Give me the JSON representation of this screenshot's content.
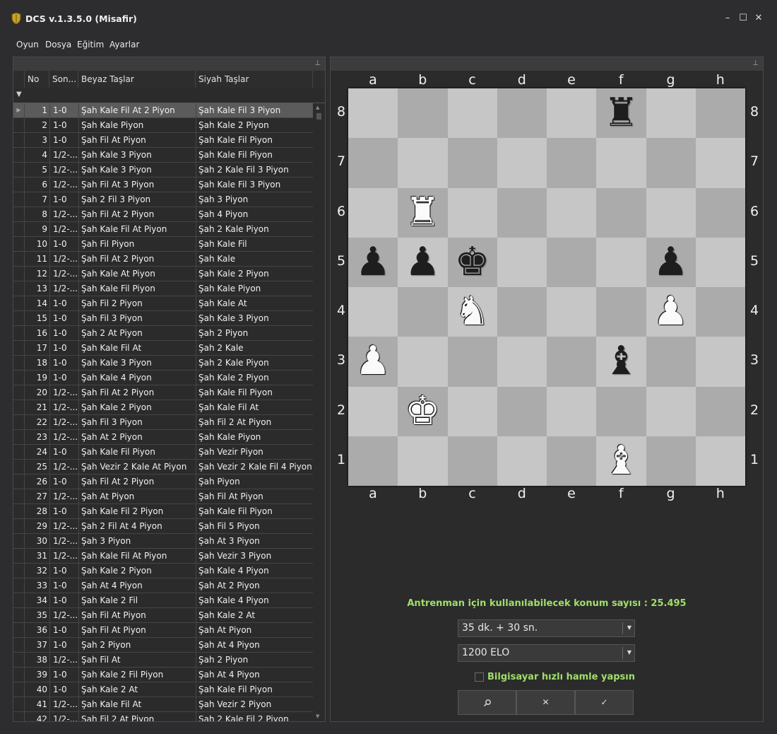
{
  "window": {
    "title": "DCS v.1.3.5.0 (Misafir)",
    "minimize_glyph": "–",
    "maximize_glyph": "☐",
    "close_glyph": "✕",
    "app_icon": "shield-icon"
  },
  "menu": [
    "Oyun",
    "Dosya",
    "Eğitim",
    "Ayarlar"
  ],
  "grid": {
    "headers": {
      "no": "No",
      "result": "Son...",
      "white": "Beyaz Taşlar",
      "black": "Siyah Taşlar"
    },
    "selected_index": 0,
    "rows": [
      {
        "no": "1",
        "result": "1-0",
        "white": "Şah Kale Fil At 2 Piyon",
        "black": "Şah Kale Fil 3 Piyon"
      },
      {
        "no": "2",
        "result": "1-0",
        "white": "Şah Kale Piyon",
        "black": "Şah Kale 2 Piyon"
      },
      {
        "no": "3",
        "result": "1-0",
        "white": "Şah Fil At Piyon",
        "black": "Şah Kale Fil Piyon"
      },
      {
        "no": "4",
        "result": "1/2-...",
        "white": "Şah Kale 3 Piyon",
        "black": "Şah Kale Fil Piyon"
      },
      {
        "no": "5",
        "result": "1/2-...",
        "white": "Şah Kale 3 Piyon",
        "black": "Şah 2 Kale Fil 3 Piyon"
      },
      {
        "no": "6",
        "result": "1/2-...",
        "white": "Şah Fil At 3 Piyon",
        "black": "Şah Kale Fil 3 Piyon"
      },
      {
        "no": "7",
        "result": "1-0",
        "white": "Şah 2 Fil 3 Piyon",
        "black": "Şah 3 Piyon"
      },
      {
        "no": "8",
        "result": "1/2-...",
        "white": "Şah Fil At 2 Piyon",
        "black": "Şah 4 Piyon"
      },
      {
        "no": "9",
        "result": "1/2-...",
        "white": "Şah Kale Fil At Piyon",
        "black": "Şah 2 Kale Piyon"
      },
      {
        "no": "10",
        "result": "1-0",
        "white": "Şah Fil Piyon",
        "black": "Şah Kale Fil"
      },
      {
        "no": "11",
        "result": "1/2-...",
        "white": "Şah Fil At 2 Piyon",
        "black": "Şah Kale"
      },
      {
        "no": "12",
        "result": "1/2-...",
        "white": "Şah Kale At Piyon",
        "black": "Şah Kale 2 Piyon"
      },
      {
        "no": "13",
        "result": "1/2-...",
        "white": "Şah Kale Fil Piyon",
        "black": "Şah Kale Piyon"
      },
      {
        "no": "14",
        "result": "1-0",
        "white": "Şah Fil 2 Piyon",
        "black": "Şah Kale At"
      },
      {
        "no": "15",
        "result": "1-0",
        "white": "Şah Fil 3 Piyon",
        "black": "Şah Kale 3 Piyon"
      },
      {
        "no": "16",
        "result": "1-0",
        "white": "Şah 2 At Piyon",
        "black": "Şah 2 Piyon"
      },
      {
        "no": "17",
        "result": "1-0",
        "white": "Şah Kale Fil At",
        "black": "Şah 2 Kale"
      },
      {
        "no": "18",
        "result": "1-0",
        "white": "Şah Kale 3 Piyon",
        "black": "Şah 2 Kale Piyon"
      },
      {
        "no": "19",
        "result": "1-0",
        "white": "Şah Kale 4 Piyon",
        "black": "Şah Kale 2 Piyon"
      },
      {
        "no": "20",
        "result": "1/2-...",
        "white": "Şah Fil At 2 Piyon",
        "black": "Şah Kale Fil Piyon"
      },
      {
        "no": "21",
        "result": "1/2-...",
        "white": "Şah Kale 2 Piyon",
        "black": "Şah Kale Fil At"
      },
      {
        "no": "22",
        "result": "1/2-...",
        "white": "Şah Fil 3 Piyon",
        "black": "Şah Fil 2 At Piyon"
      },
      {
        "no": "23",
        "result": "1/2-...",
        "white": "Şah At 2 Piyon",
        "black": "Şah Kale Piyon"
      },
      {
        "no": "24",
        "result": "1-0",
        "white": "Şah Kale Fil Piyon",
        "black": "Şah Vezir Piyon"
      },
      {
        "no": "25",
        "result": "1/2-...",
        "white": "Şah Vezir 2 Kale At Piyon",
        "black": "Şah Vezir 2 Kale Fil 4 Piyon"
      },
      {
        "no": "26",
        "result": "1-0",
        "white": "Şah Fil At 2 Piyon",
        "black": "Şah Piyon"
      },
      {
        "no": "27",
        "result": "1/2-...",
        "white": "Şah At Piyon",
        "black": "Şah Fil At Piyon"
      },
      {
        "no": "28",
        "result": "1-0",
        "white": "Şah Kale Fil 2 Piyon",
        "black": "Şah Kale Fil Piyon"
      },
      {
        "no": "29",
        "result": "1/2-...",
        "white": "Şah 2 Fil At 4 Piyon",
        "black": "Şah Fil 5 Piyon"
      },
      {
        "no": "30",
        "result": "1/2-...",
        "white": "Şah 3 Piyon",
        "black": "Şah At 3 Piyon"
      },
      {
        "no": "31",
        "result": "1/2-...",
        "white": "Şah Kale Fil At Piyon",
        "black": "Şah Vezir 3 Piyon"
      },
      {
        "no": "32",
        "result": "1-0",
        "white": "Şah Kale 2 Piyon",
        "black": "Şah Kale 4 Piyon"
      },
      {
        "no": "33",
        "result": "1-0",
        "white": "Şah At 4 Piyon",
        "black": "Şah At 2 Piyon"
      },
      {
        "no": "34",
        "result": "1-0",
        "white": "Şah Kale 2 Fil",
        "black": "Şah Kale 4 Piyon"
      },
      {
        "no": "35",
        "result": "1/2-...",
        "white": "Şah Fil At Piyon",
        "black": "Şah Kale 2 At"
      },
      {
        "no": "36",
        "result": "1-0",
        "white": "Şah Fil At Piyon",
        "black": "Şah At Piyon"
      },
      {
        "no": "37",
        "result": "1-0",
        "white": "Şah 2 Piyon",
        "black": "Şah At 4 Piyon"
      },
      {
        "no": "38",
        "result": "1/2-...",
        "white": "Şah Fil At",
        "black": "Şah 2 Piyon"
      },
      {
        "no": "39",
        "result": "1-0",
        "white": "Şah Kale 2 Fil Piyon",
        "black": "Şah At 4 Piyon"
      },
      {
        "no": "40",
        "result": "1-0",
        "white": "Şah Kale 2 At",
        "black": "Şah Kale Fil Piyon"
      },
      {
        "no": "41",
        "result": "1/2-...",
        "white": "Şah Kale Fil At",
        "black": "Şah Vezir 2 Piyon"
      },
      {
        "no": "42",
        "result": "1/2-...",
        "white": "Şah Fil 2 At Piyon",
        "black": "Şah 2 Kale Fil 2 Piyon"
      }
    ]
  },
  "board": {
    "files": [
      "a",
      "b",
      "c",
      "d",
      "e",
      "f",
      "g",
      "h"
    ],
    "ranks": [
      "8",
      "7",
      "6",
      "5",
      "4",
      "3",
      "2",
      "1"
    ],
    "pieces": [
      {
        "square": "f8",
        "color": "black",
        "type": "rook",
        "glyph": "♜"
      },
      {
        "square": "b6",
        "color": "white",
        "type": "rook",
        "glyph": "♜"
      },
      {
        "square": "a5",
        "color": "black",
        "type": "pawn",
        "glyph": "♟"
      },
      {
        "square": "b5",
        "color": "black",
        "type": "pawn",
        "glyph": "♟"
      },
      {
        "square": "c5",
        "color": "black",
        "type": "king",
        "glyph": "♚"
      },
      {
        "square": "g5",
        "color": "black",
        "type": "pawn",
        "glyph": "♟"
      },
      {
        "square": "c4",
        "color": "white",
        "type": "knight",
        "glyph": "♞"
      },
      {
        "square": "g4",
        "color": "white",
        "type": "pawn",
        "glyph": "♟"
      },
      {
        "square": "a3",
        "color": "white",
        "type": "pawn",
        "glyph": "♟"
      },
      {
        "square": "f3",
        "color": "black",
        "type": "bishop",
        "glyph": "♝"
      },
      {
        "square": "b2",
        "color": "white",
        "type": "king",
        "glyph": "♚"
      },
      {
        "square": "f1",
        "color": "white",
        "type": "bishop",
        "glyph": "♝"
      }
    ]
  },
  "training": {
    "positions_text": "Antrenman için kullanılabilecek konum sayısı : 25.495",
    "time_control": "35 dk. + 30 sn.",
    "elo": "1200 ELO",
    "fast_move_label": "Bilgisayar hızlı hamle yapsın",
    "fast_move_checked": false,
    "buttons": [
      {
        "name": "search-button",
        "icon": "magnifier-icon",
        "glyph": "⚲"
      },
      {
        "name": "cancel-button",
        "icon": "close-icon",
        "glyph": "✕"
      },
      {
        "name": "confirm-button",
        "icon": "check-icon",
        "glyph": "✓"
      }
    ]
  },
  "colors": {
    "accent_text": "#9fdf6a",
    "background": "#2d2d30",
    "board_light": "#c6c6c6",
    "board_dark": "#ababab"
  }
}
